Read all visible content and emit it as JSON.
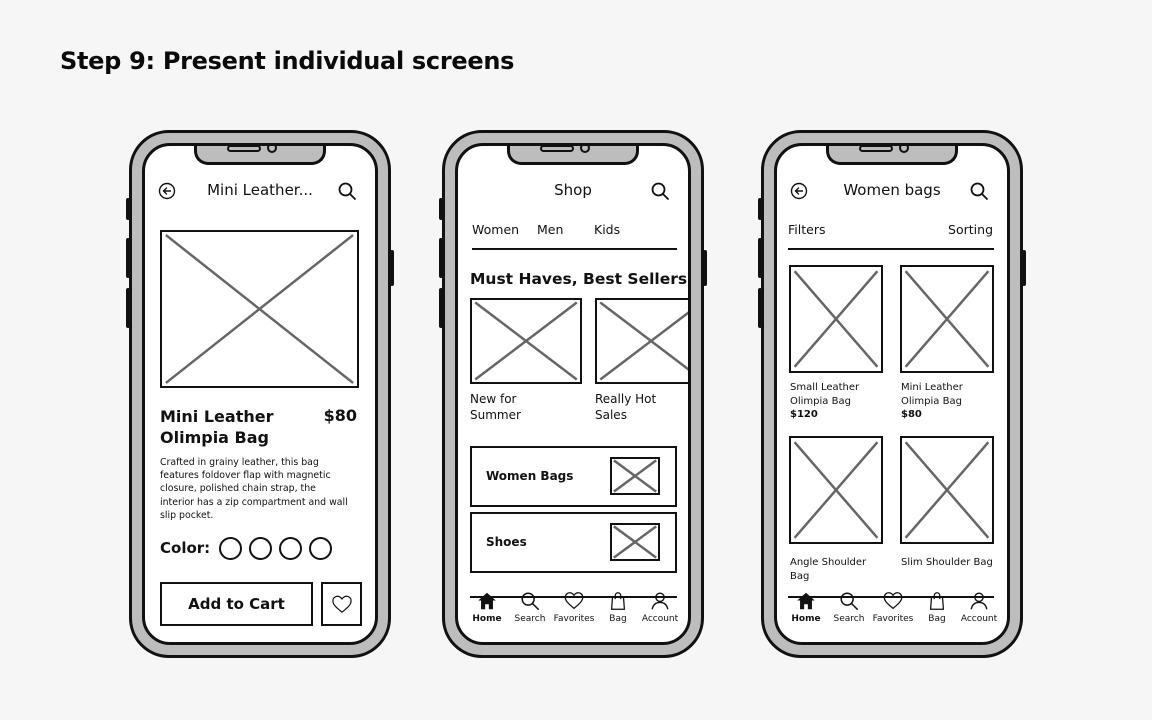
{
  "step_title": "Step 9: Present individual screens",
  "colors": {
    "ink": "#111111",
    "frame": "#bdbdbd",
    "placeholder_x": "#666666",
    "background": "#f6f6f6"
  },
  "phones": [
    {
      "name": "product-detail",
      "header": {
        "title": "Mini Leather...",
        "back_icon": "back-arrow-circle-icon",
        "search_icon": "search-icon"
      },
      "product": {
        "name_line1": "Mini Leather",
        "name_line2": "Olimpia Bag",
        "price": "$80",
        "description": [
          "Crafted in grainy leather, this bag",
          "features foldover flap with magnetic",
          "closure, polished chain strap, the",
          "interior has a zip compartment and wall",
          "slip pocket."
        ],
        "color_label": "Color:",
        "color_options": 4,
        "add_to_cart": "Add to Cart",
        "favorite_icon": "heart-icon"
      }
    },
    {
      "name": "shop-home",
      "header": {
        "title": "Shop",
        "search_icon": "search-icon"
      },
      "tabs": [
        "Women",
        "Men",
        "Kids"
      ],
      "section_title": "Must Haves, Best Sellers",
      "carousel": [
        {
          "line1": "New for",
          "line2": "Summer"
        },
        {
          "line1": "Really Hot",
          "line2": "Sales"
        }
      ],
      "categories": [
        "Women Bags",
        "Shoes"
      ],
      "nav": [
        {
          "label": "Home",
          "icon": "home-icon",
          "active": true
        },
        {
          "label": "Search",
          "icon": "search-icon"
        },
        {
          "label": "Favorites",
          "icon": "heart-icon"
        },
        {
          "label": "Bag",
          "icon": "shopping-bag-icon"
        },
        {
          "label": "Account",
          "icon": "account-icon"
        }
      ]
    },
    {
      "name": "product-list",
      "header": {
        "title": "Women bags",
        "back_icon": "back-arrow-circle-icon",
        "search_icon": "search-icon"
      },
      "filters_label": "Filters",
      "sorting_label": "Sorting",
      "products": [
        {
          "line1": "Small Leather",
          "line2": "Olimpia Bag",
          "price": "$120"
        },
        {
          "line1": "Mini Leather",
          "line2": "Olimpia Bag",
          "price": "$80"
        },
        {
          "line1": "Angle Shoulder",
          "line2": "Bag",
          "price": ""
        },
        {
          "line1": "Slim Shoulder Bag",
          "line2": "",
          "price": ""
        }
      ],
      "nav": [
        {
          "label": "Home",
          "icon": "home-icon",
          "active": true
        },
        {
          "label": "Search",
          "icon": "search-icon"
        },
        {
          "label": "Favorites",
          "icon": "heart-icon"
        },
        {
          "label": "Bag",
          "icon": "shopping-bag-icon"
        },
        {
          "label": "Account",
          "icon": "account-icon"
        }
      ]
    }
  ]
}
